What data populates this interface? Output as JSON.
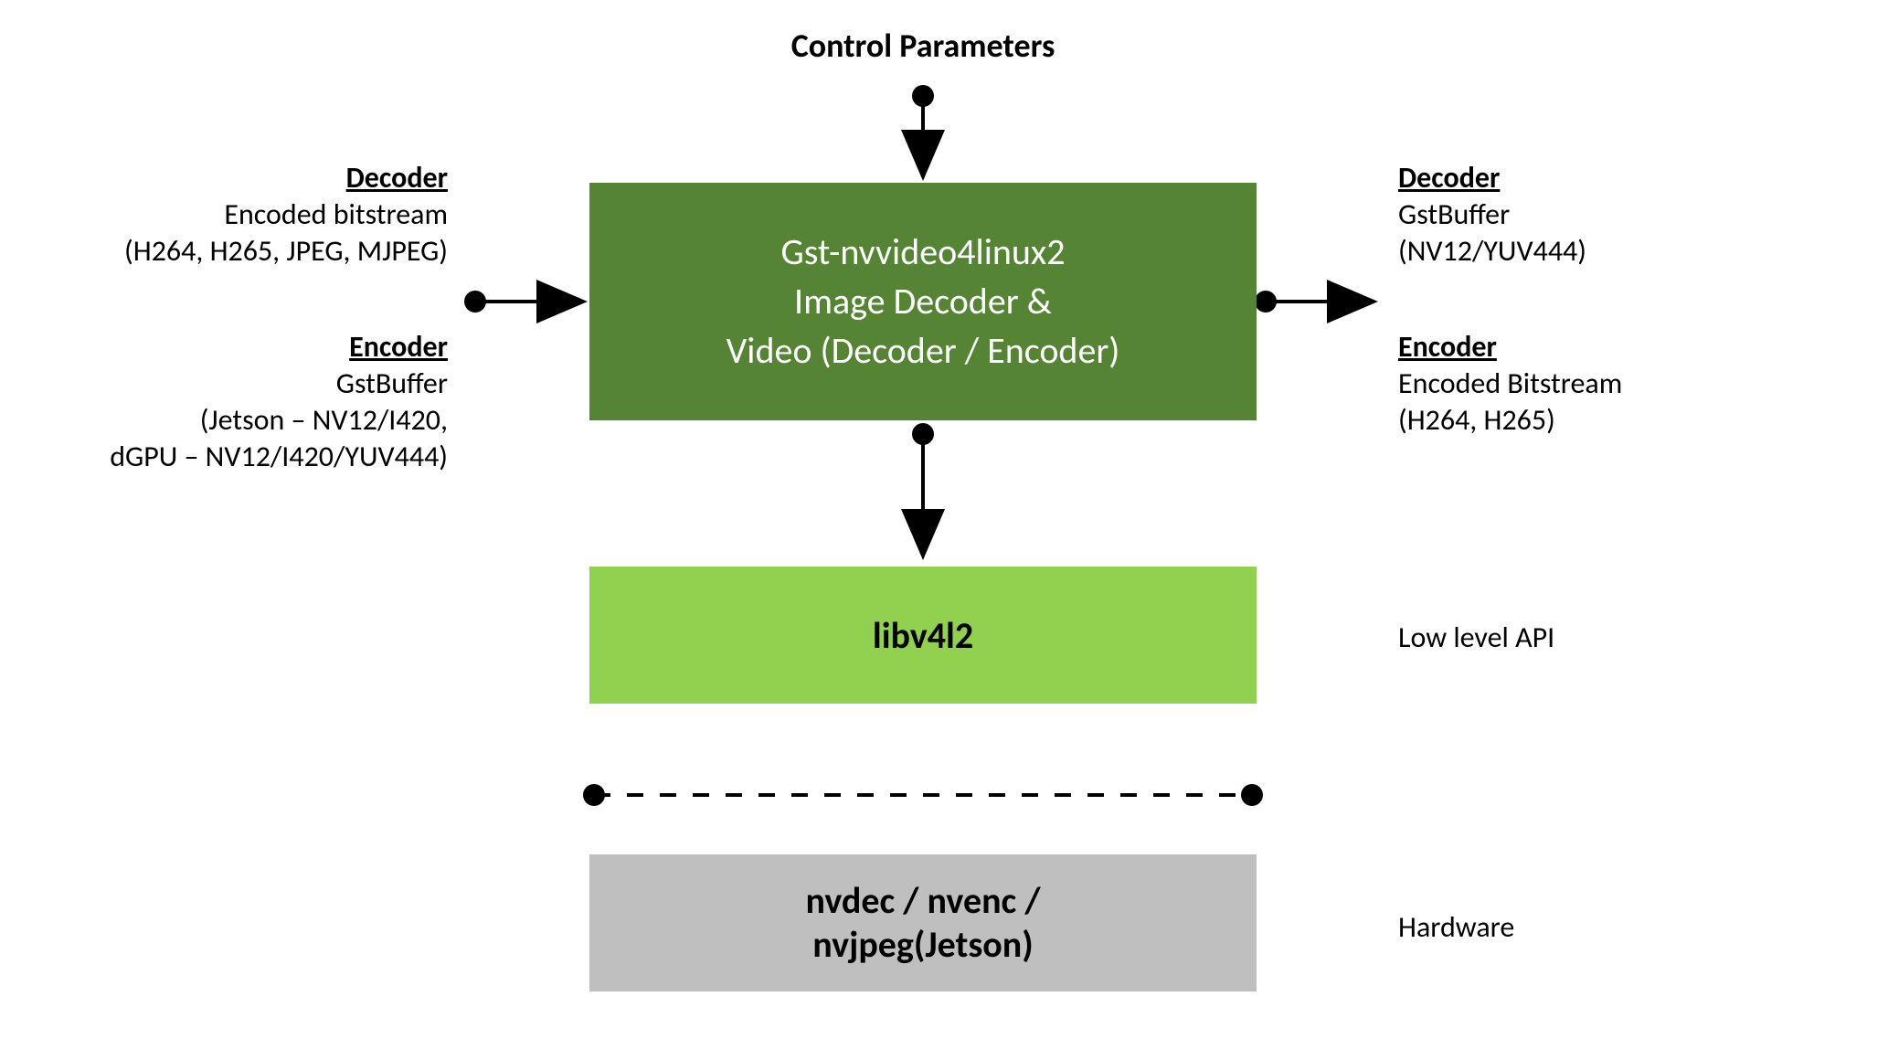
{
  "top": {
    "title": "Control Parameters"
  },
  "left": {
    "decoder": {
      "head": "Decoder",
      "l1": "Encoded bitstream",
      "l2": "(H264, H265, JPEG, MJPEG)"
    },
    "encoder": {
      "head": "Encoder",
      "l1": "GstBuffer",
      "l2": "(Jetson – NV12/I420,",
      "l3": "dGPU – NV12/I420/YUV444)"
    }
  },
  "center": {
    "main": {
      "l1": "Gst-nvvideo4linux2",
      "l2": "Image Decoder &",
      "l3": "Video (Decoder / Encoder)"
    },
    "lib": "libv4l2",
    "hw": {
      "l1": "nvdec / nvenc /",
      "l2": "nvjpeg(Jetson)"
    }
  },
  "right": {
    "decoder": {
      "head": "Decoder",
      "l1": "GstBuffer",
      "l2": "(NV12/YUV444)"
    },
    "encoder": {
      "head": "Encoder",
      "l1": "Encoded Bitstream",
      "l2": "(H264, H265)"
    },
    "lowlevel": "Low level API",
    "hardware": "Hardware"
  }
}
